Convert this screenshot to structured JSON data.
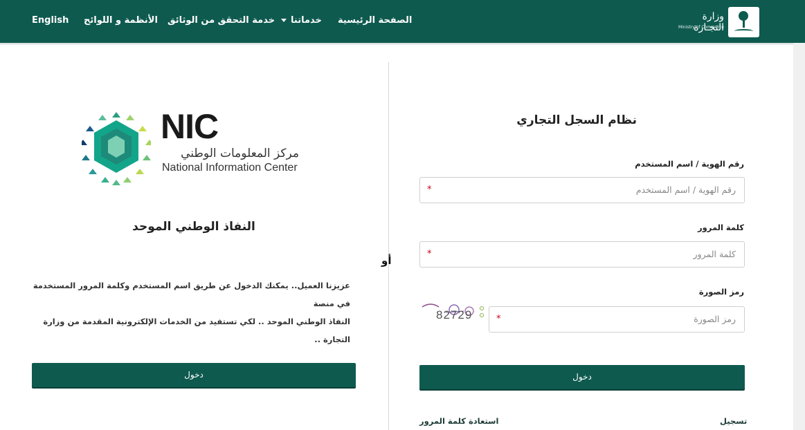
{
  "header": {
    "brand_ar": "وزارة التجـارة",
    "brand_en": "Ministry of Commerce",
    "nav": {
      "language": "English",
      "regulations": "الأنظمة و اللوائح",
      "verify_docs": "خدمة التحقق من الوثائق",
      "services": "خدماتنا",
      "home": "الصفحة الرئيسية"
    },
    "colors": {
      "primary": "#0e5a4f",
      "white": "#ffffff"
    }
  },
  "nic": {
    "logo_word": "NIC",
    "logo_ar": "مركز المعلومات الوطني",
    "logo_en": "National Information Center",
    "title": "النفاذ الوطني الموحد",
    "description_line1": "عزيزنا العميل.. يمكنك الدخول عن طريق اسم المستخدم وكلمة المرور المستخدمة في منصة",
    "description_line2": "النفاذ الوطني الموحد .. لكي تستفيد من الخدمات الإلكترونية المقدمة من وزارة التجارة ..",
    "login_button": "دخول"
  },
  "separator": {
    "or": "أو"
  },
  "login": {
    "title": "نظام السجل التجاري",
    "user_label": "رقم الهوية / اسم المستخدم",
    "user_placeholder": "رقم الهوية / اسم المستخدم",
    "password_label": "كلمة المرور",
    "password_placeholder": "كلمة المرور",
    "captcha_label": "رمز الصورة",
    "captcha_placeholder": "رمز الصورة",
    "captcha_code": "82729",
    "required_mark": "*",
    "login_button": "دخول",
    "register_link": "تسجيل",
    "forgot_link": "استعادة كلمة المرور"
  }
}
